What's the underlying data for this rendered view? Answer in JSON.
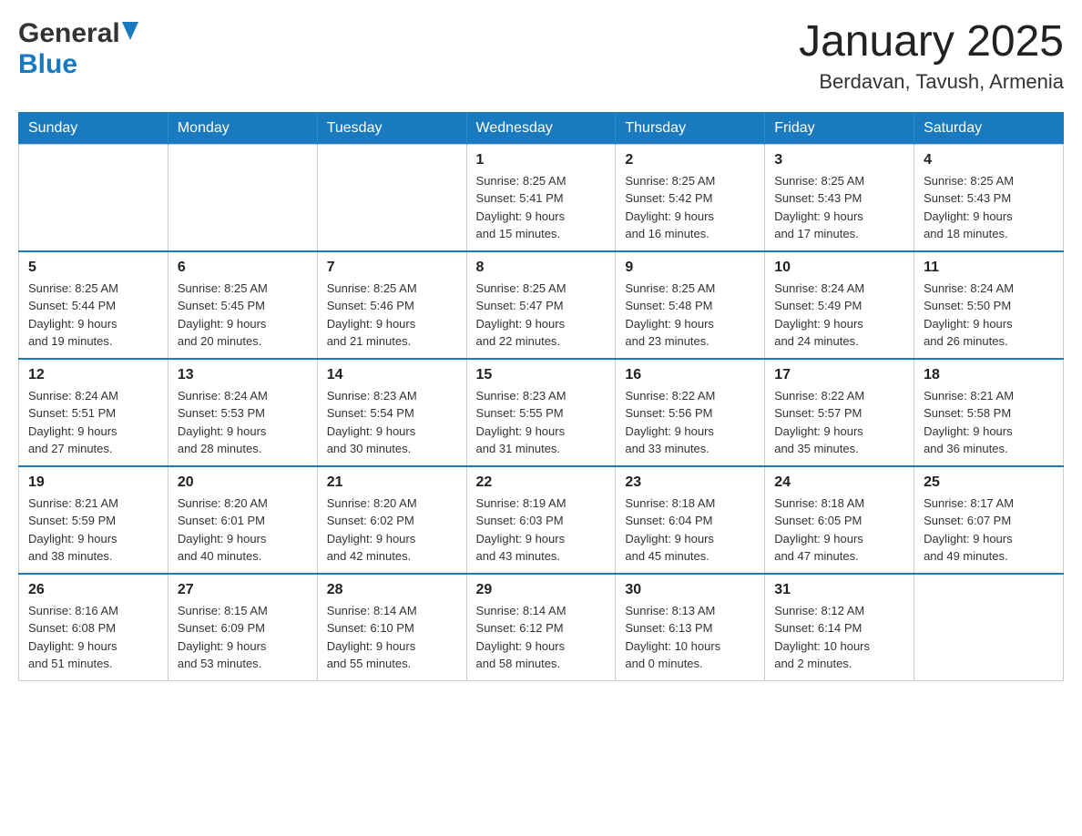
{
  "header": {
    "logo_general": "General",
    "logo_blue": "Blue",
    "title": "January 2025",
    "subtitle": "Berdavan, Tavush, Armenia"
  },
  "weekdays": [
    "Sunday",
    "Monday",
    "Tuesday",
    "Wednesday",
    "Thursday",
    "Friday",
    "Saturday"
  ],
  "weeks": [
    [
      {
        "day": "",
        "info": ""
      },
      {
        "day": "",
        "info": ""
      },
      {
        "day": "",
        "info": ""
      },
      {
        "day": "1",
        "info": "Sunrise: 8:25 AM\nSunset: 5:41 PM\nDaylight: 9 hours\nand 15 minutes."
      },
      {
        "day": "2",
        "info": "Sunrise: 8:25 AM\nSunset: 5:42 PM\nDaylight: 9 hours\nand 16 minutes."
      },
      {
        "day": "3",
        "info": "Sunrise: 8:25 AM\nSunset: 5:43 PM\nDaylight: 9 hours\nand 17 minutes."
      },
      {
        "day": "4",
        "info": "Sunrise: 8:25 AM\nSunset: 5:43 PM\nDaylight: 9 hours\nand 18 minutes."
      }
    ],
    [
      {
        "day": "5",
        "info": "Sunrise: 8:25 AM\nSunset: 5:44 PM\nDaylight: 9 hours\nand 19 minutes."
      },
      {
        "day": "6",
        "info": "Sunrise: 8:25 AM\nSunset: 5:45 PM\nDaylight: 9 hours\nand 20 minutes."
      },
      {
        "day": "7",
        "info": "Sunrise: 8:25 AM\nSunset: 5:46 PM\nDaylight: 9 hours\nand 21 minutes."
      },
      {
        "day": "8",
        "info": "Sunrise: 8:25 AM\nSunset: 5:47 PM\nDaylight: 9 hours\nand 22 minutes."
      },
      {
        "day": "9",
        "info": "Sunrise: 8:25 AM\nSunset: 5:48 PM\nDaylight: 9 hours\nand 23 minutes."
      },
      {
        "day": "10",
        "info": "Sunrise: 8:24 AM\nSunset: 5:49 PM\nDaylight: 9 hours\nand 24 minutes."
      },
      {
        "day": "11",
        "info": "Sunrise: 8:24 AM\nSunset: 5:50 PM\nDaylight: 9 hours\nand 26 minutes."
      }
    ],
    [
      {
        "day": "12",
        "info": "Sunrise: 8:24 AM\nSunset: 5:51 PM\nDaylight: 9 hours\nand 27 minutes."
      },
      {
        "day": "13",
        "info": "Sunrise: 8:24 AM\nSunset: 5:53 PM\nDaylight: 9 hours\nand 28 minutes."
      },
      {
        "day": "14",
        "info": "Sunrise: 8:23 AM\nSunset: 5:54 PM\nDaylight: 9 hours\nand 30 minutes."
      },
      {
        "day": "15",
        "info": "Sunrise: 8:23 AM\nSunset: 5:55 PM\nDaylight: 9 hours\nand 31 minutes."
      },
      {
        "day": "16",
        "info": "Sunrise: 8:22 AM\nSunset: 5:56 PM\nDaylight: 9 hours\nand 33 minutes."
      },
      {
        "day": "17",
        "info": "Sunrise: 8:22 AM\nSunset: 5:57 PM\nDaylight: 9 hours\nand 35 minutes."
      },
      {
        "day": "18",
        "info": "Sunrise: 8:21 AM\nSunset: 5:58 PM\nDaylight: 9 hours\nand 36 minutes."
      }
    ],
    [
      {
        "day": "19",
        "info": "Sunrise: 8:21 AM\nSunset: 5:59 PM\nDaylight: 9 hours\nand 38 minutes."
      },
      {
        "day": "20",
        "info": "Sunrise: 8:20 AM\nSunset: 6:01 PM\nDaylight: 9 hours\nand 40 minutes."
      },
      {
        "day": "21",
        "info": "Sunrise: 8:20 AM\nSunset: 6:02 PM\nDaylight: 9 hours\nand 42 minutes."
      },
      {
        "day": "22",
        "info": "Sunrise: 8:19 AM\nSunset: 6:03 PM\nDaylight: 9 hours\nand 43 minutes."
      },
      {
        "day": "23",
        "info": "Sunrise: 8:18 AM\nSunset: 6:04 PM\nDaylight: 9 hours\nand 45 minutes."
      },
      {
        "day": "24",
        "info": "Sunrise: 8:18 AM\nSunset: 6:05 PM\nDaylight: 9 hours\nand 47 minutes."
      },
      {
        "day": "25",
        "info": "Sunrise: 8:17 AM\nSunset: 6:07 PM\nDaylight: 9 hours\nand 49 minutes."
      }
    ],
    [
      {
        "day": "26",
        "info": "Sunrise: 8:16 AM\nSunset: 6:08 PM\nDaylight: 9 hours\nand 51 minutes."
      },
      {
        "day": "27",
        "info": "Sunrise: 8:15 AM\nSunset: 6:09 PM\nDaylight: 9 hours\nand 53 minutes."
      },
      {
        "day": "28",
        "info": "Sunrise: 8:14 AM\nSunset: 6:10 PM\nDaylight: 9 hours\nand 55 minutes."
      },
      {
        "day": "29",
        "info": "Sunrise: 8:14 AM\nSunset: 6:12 PM\nDaylight: 9 hours\nand 58 minutes."
      },
      {
        "day": "30",
        "info": "Sunrise: 8:13 AM\nSunset: 6:13 PM\nDaylight: 10 hours\nand 0 minutes."
      },
      {
        "day": "31",
        "info": "Sunrise: 8:12 AM\nSunset: 6:14 PM\nDaylight: 10 hours\nand 2 minutes."
      },
      {
        "day": "",
        "info": ""
      }
    ]
  ]
}
